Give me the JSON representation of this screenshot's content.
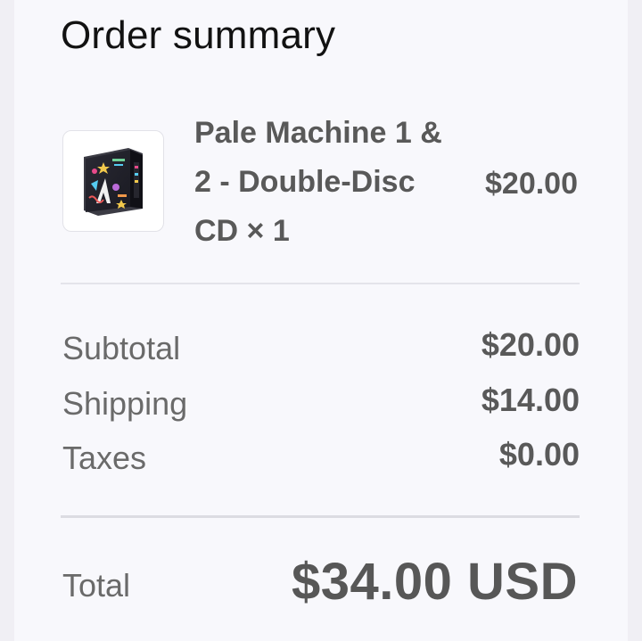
{
  "summary": {
    "title": "Order summary"
  },
  "item": {
    "name": "Pale Machine 1 & 2 - Double-Disc CD × 1",
    "price": "$20.00",
    "image_icon": "album-cover-icon"
  },
  "totals": {
    "subtotal_label": "Subtotal",
    "subtotal_value": "$20.00",
    "shipping_label": "Shipping",
    "shipping_value": "$14.00",
    "taxes_label": "Taxes",
    "taxes_value": "$0.00",
    "total_label": "Total",
    "total_value": "$34.00 USD"
  },
  "colors": {
    "background": "#f0eff4",
    "panel": "#f8f8fc",
    "title_text": "#121212",
    "body_text": "#595959",
    "label_text": "#6a6a6a",
    "divider": "#e4e4ea"
  }
}
